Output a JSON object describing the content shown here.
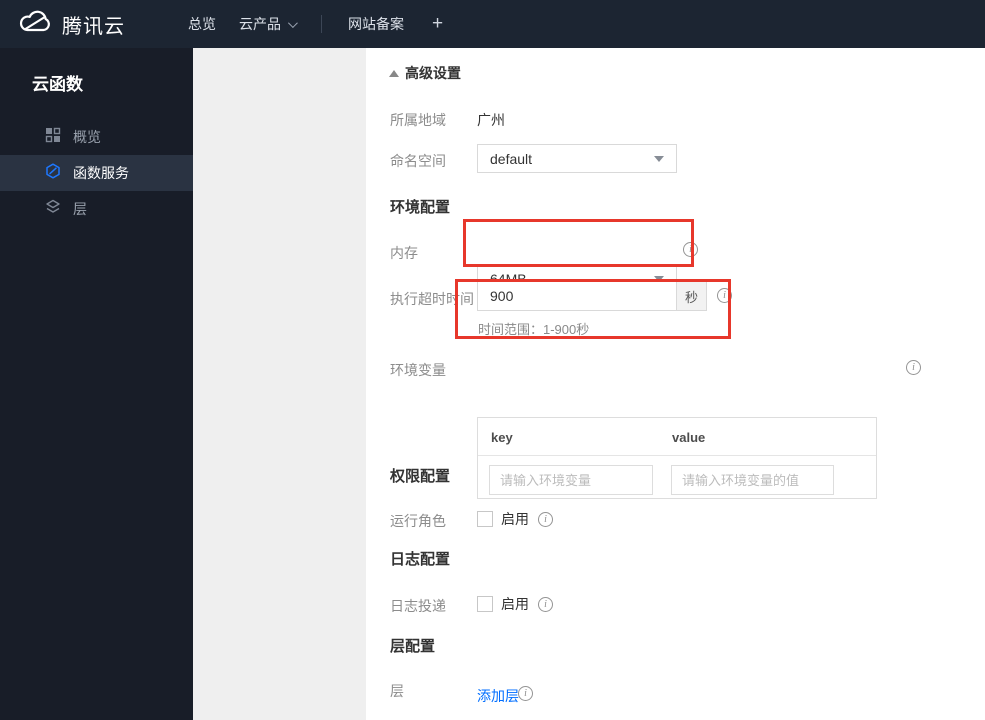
{
  "topbar": {
    "brand": "腾讯云",
    "nav": [
      {
        "label": "总览"
      },
      {
        "label": "云产品"
      },
      {
        "label": "网站备案"
      }
    ],
    "add_label": "+"
  },
  "sidebar": {
    "title": "云函数",
    "items": [
      {
        "label": "概览",
        "icon": "overview-grid-icon",
        "active": false
      },
      {
        "label": "函数服务",
        "icon": "scf-hexagon-icon",
        "active": true
      },
      {
        "label": "层",
        "icon": "layers-icon",
        "active": false
      }
    ]
  },
  "form": {
    "advanced_toggle": "高级设置",
    "region": {
      "label": "所属地域",
      "value": "广州"
    },
    "namespace": {
      "label": "命名空间",
      "value": "default"
    },
    "env_section": "环境配置",
    "memory": {
      "label": "内存",
      "value": "64MB"
    },
    "timeout": {
      "label": "执行超时时间",
      "value": "900",
      "unit": "秒",
      "hint": "时间范围：1-900秒"
    },
    "env_vars": {
      "label": "环境变量",
      "key_header": "key",
      "value_header": "value",
      "key_placeholder": "请输入环境变量",
      "value_placeholder": "请输入环境变量的值"
    },
    "perm_section": "权限配置",
    "run_role": {
      "label": "运行角色",
      "checkbox_label": "启用",
      "checked": false
    },
    "log_section": "日志配置",
    "log_delivery": {
      "label": "日志投递",
      "checkbox_label": "启用",
      "checked": false
    },
    "layer_section": "层配置",
    "layer": {
      "label": "层",
      "link": "添加层"
    }
  },
  "colors": {
    "accent": "#006eff",
    "annotation_red": "#e7372b",
    "topbar_bg": "#1c2532",
    "sidebar_bg": "#181d28",
    "sidebar_active_bg": "#2a3342",
    "panel_gray": "#efefef"
  }
}
